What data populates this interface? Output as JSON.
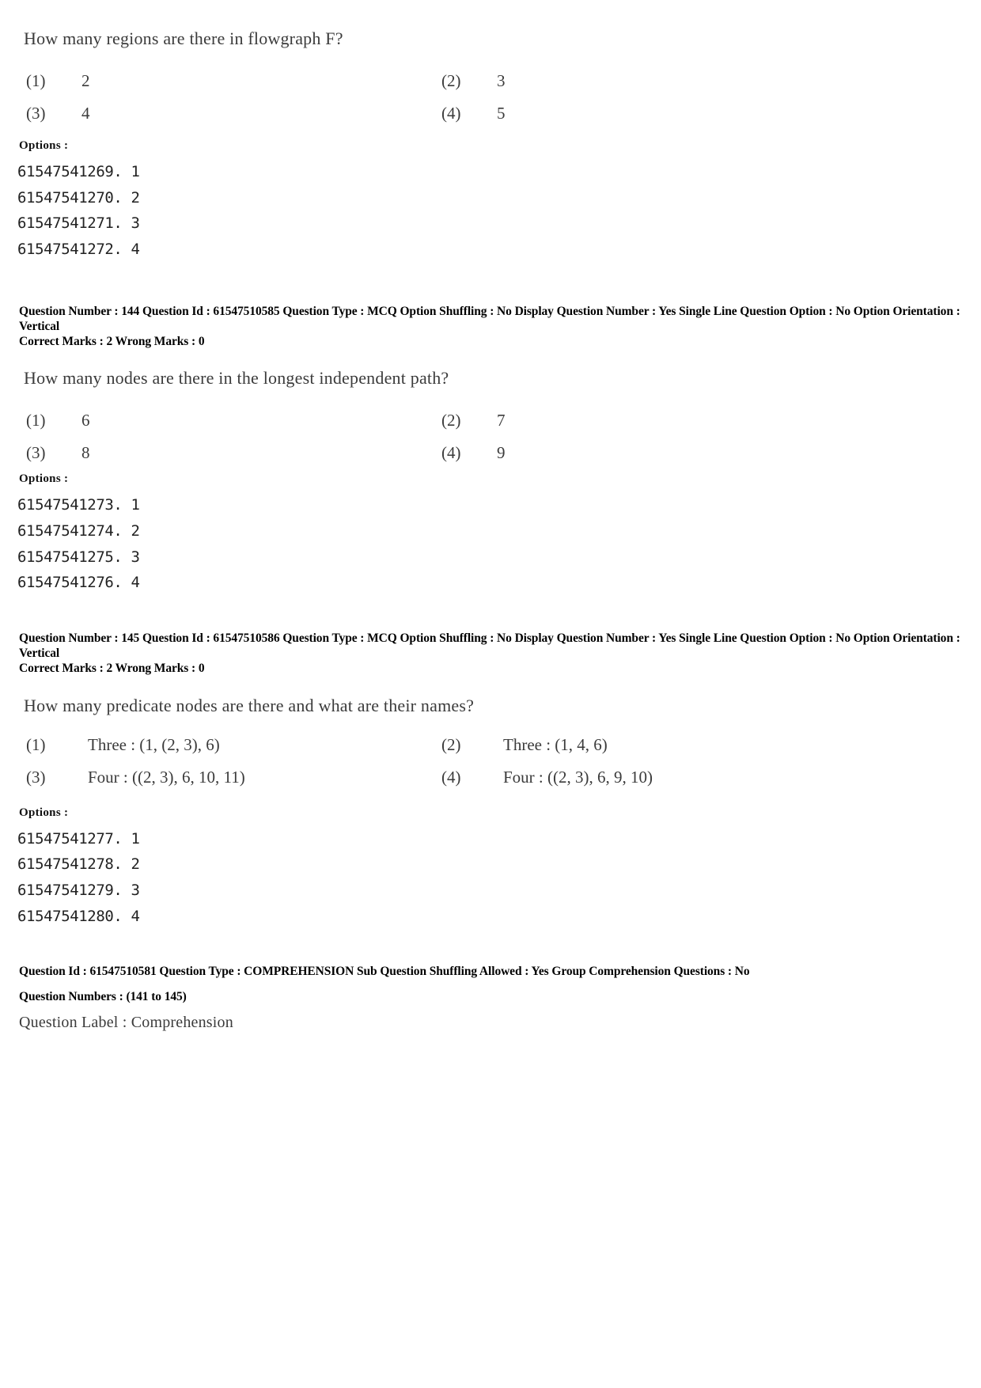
{
  "labels": {
    "options_label": "Options :"
  },
  "blocks": [
    {
      "id": "q143",
      "stem": "How many regions are there in flowgraph F?",
      "choices": [
        {
          "marker": "(1)",
          "text": "2"
        },
        {
          "marker": "(2)",
          "text": "3"
        },
        {
          "marker": "(3)",
          "text": "4"
        },
        {
          "marker": "(4)",
          "text": "5"
        }
      ],
      "option_ids": [
        "61547541269. 1",
        "61547541270. 2",
        "61547541271. 3",
        "61547541272. 4"
      ]
    },
    {
      "id": "q144",
      "meta": {
        "line1": "Question Number : 144  Question Id : 61547510585  Question Type : MCQ  Option Shuffling : No  Display Question Number : Yes  Single Line Question Option : No  Option Orientation : Vertical",
        "line2": "Correct Marks : 2  Wrong Marks : 0"
      },
      "stem": "How many nodes are there in the longest independent path?",
      "choices": [
        {
          "marker": "(1)",
          "text": "6"
        },
        {
          "marker": "(2)",
          "text": "7"
        },
        {
          "marker": "(3)",
          "text": "8"
        },
        {
          "marker": "(4)",
          "text": "9"
        }
      ],
      "option_ids": [
        "61547541273. 1",
        "61547541274. 2",
        "61547541275. 3",
        "61547541276. 4"
      ]
    },
    {
      "id": "q145",
      "meta": {
        "line1": "Question Number : 145  Question Id : 61547510586  Question Type : MCQ  Option Shuffling : No  Display Question Number : Yes  Single Line Question Option : No  Option Orientation : Vertical",
        "line2": "Correct Marks : 2  Wrong Marks : 0"
      },
      "stem": "How many predicate nodes are there and what are their names?",
      "choices": [
        {
          "marker": "(1)",
          "text": "Three : (1, (2, 3), 6)"
        },
        {
          "marker": "(2)",
          "text": "Three : (1, 4, 6)"
        },
        {
          "marker": "(3)",
          "text": "Four : ((2, 3),  6, 10, 11)"
        },
        {
          "marker": "(4)",
          "text": "Four : ((2, 3), 6, 9, 10)"
        }
      ],
      "option_ids": [
        "61547541277. 1",
        "61547541278. 2",
        "61547541279. 3",
        "61547541280. 4"
      ]
    }
  ],
  "comprehension": {
    "meta_line1": "Question Id : 61547510581  Question Type : COMPREHENSION  Sub Question Shuffling Allowed : Yes  Group Comprehension Questions : No",
    "meta_line2": "Question Numbers : (141 to 145)",
    "label": "Question Label : Comprehension"
  }
}
